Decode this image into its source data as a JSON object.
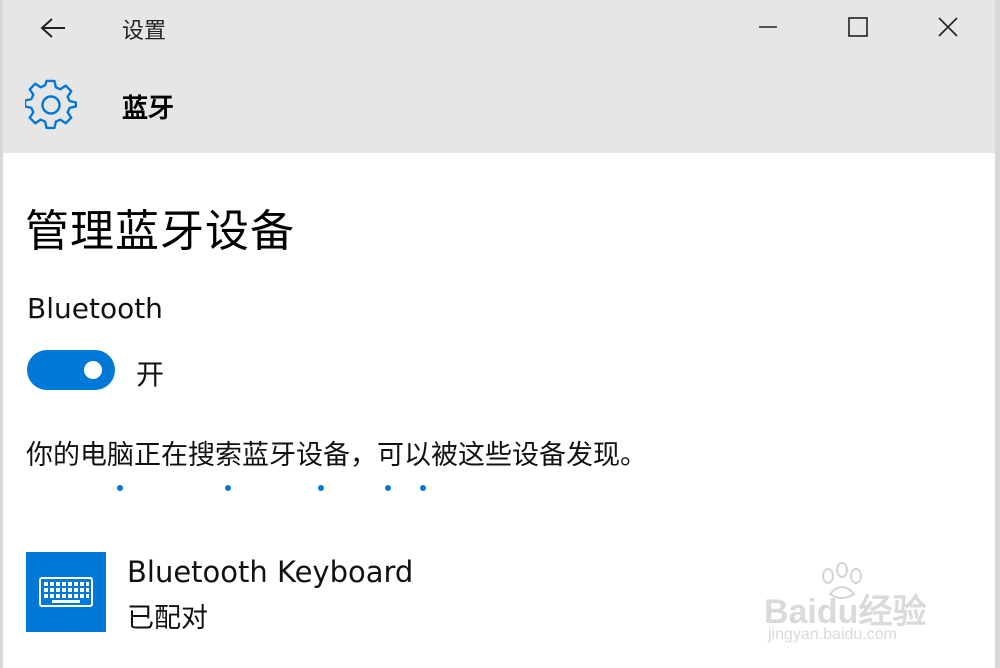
{
  "window": {
    "title": "设置",
    "back_icon": "arrow-left-icon",
    "controls": [
      "minimize-icon",
      "maximize-icon",
      "close-icon"
    ]
  },
  "header": {
    "icon": "gear-icon",
    "title": "蓝牙"
  },
  "main": {
    "heading": "管理蓝牙设备",
    "bluetooth_label": "Bluetooth",
    "toggle": {
      "on": true,
      "state_label": "开"
    },
    "status_text": "你的电脑正在搜索蓝牙设备，可以被这些设备发现。",
    "devices": [
      {
        "name": "Bluetooth Keyboard",
        "status": "已配对",
        "icon": "keyboard-icon"
      }
    ]
  },
  "watermark": {
    "brand": "Baidu经验",
    "url": "jingyan.baidu.com"
  },
  "colors": {
    "accent": "#0078d7",
    "titlebar_bg": "#e6e6e6",
    "content_bg": "#ffffff"
  }
}
